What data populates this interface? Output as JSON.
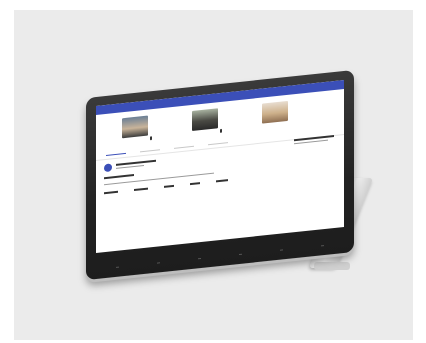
{
  "scene": {
    "description_colors": {
      "background": "#ebebeb",
      "bezel": "#222222",
      "app_bar": "#3b4fb8"
    }
  },
  "app": {
    "title": "",
    "participants": [
      {
        "name": ""
      },
      {
        "name": ""
      },
      {
        "name": ""
      }
    ],
    "brand_logo": ""
  }
}
